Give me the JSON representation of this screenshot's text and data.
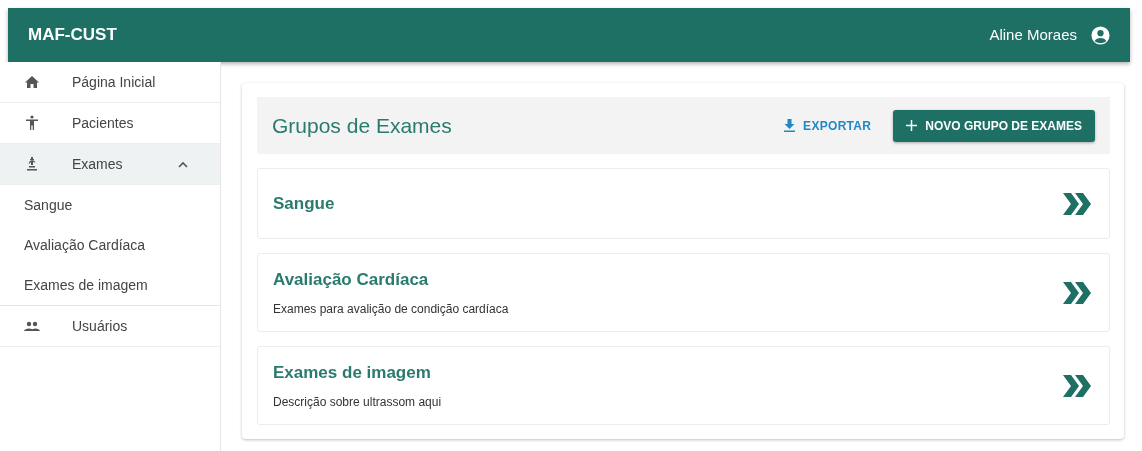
{
  "app_bar": {
    "title": "MAF-CUST",
    "user": "Aline Moraes"
  },
  "sidebar": {
    "items": [
      {
        "label": "Página Inicial"
      },
      {
        "label": "Pacientes"
      },
      {
        "label": "Exames",
        "expanded": true,
        "children": [
          {
            "label": "Sangue"
          },
          {
            "label": "Avaliação Cardíaca"
          },
          {
            "label": "Exames de imagem"
          }
        ]
      },
      {
        "label": "Usuários"
      }
    ]
  },
  "panel": {
    "title": "Grupos de Exames",
    "export_label": "EXPORTAR",
    "new_label": "NOVO GRUPO DE EXAMES",
    "groups": [
      {
        "name": "Sangue"
      },
      {
        "name": "Avaliação Cardíaca",
        "description": "Exames para avalição de condição cardíaca"
      },
      {
        "name": "Exames de imagem",
        "description": "Descrição sobre ultrassom aqui"
      }
    ]
  }
}
